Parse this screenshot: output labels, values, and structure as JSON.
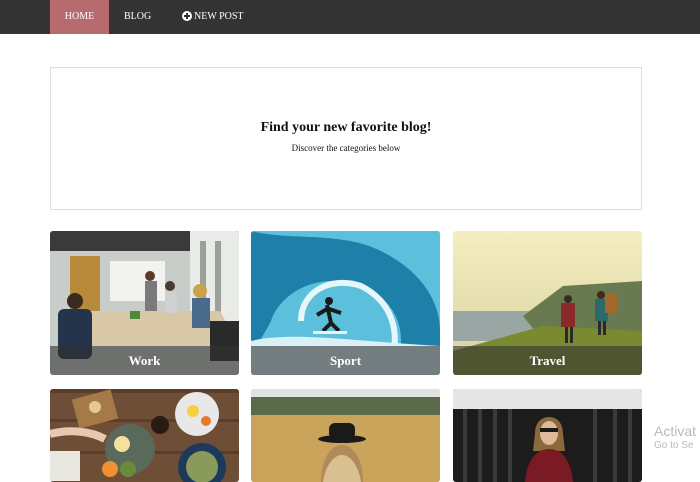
{
  "nav": {
    "home": "HOME",
    "blog": "BLOG",
    "new_post": "NEW POST",
    "active_color": "#b76b6e",
    "bg_color": "#333333"
  },
  "hero": {
    "title": "Find your new favorite blog!",
    "subtitle": "Discover the categories below"
  },
  "categories": [
    {
      "label": "Work"
    },
    {
      "label": "Sport"
    },
    {
      "label": "Travel"
    },
    {
      "label": ""
    },
    {
      "label": ""
    },
    {
      "label": ""
    }
  ],
  "watermark": {
    "line1": "Activat",
    "line2": "Go to Se"
  }
}
